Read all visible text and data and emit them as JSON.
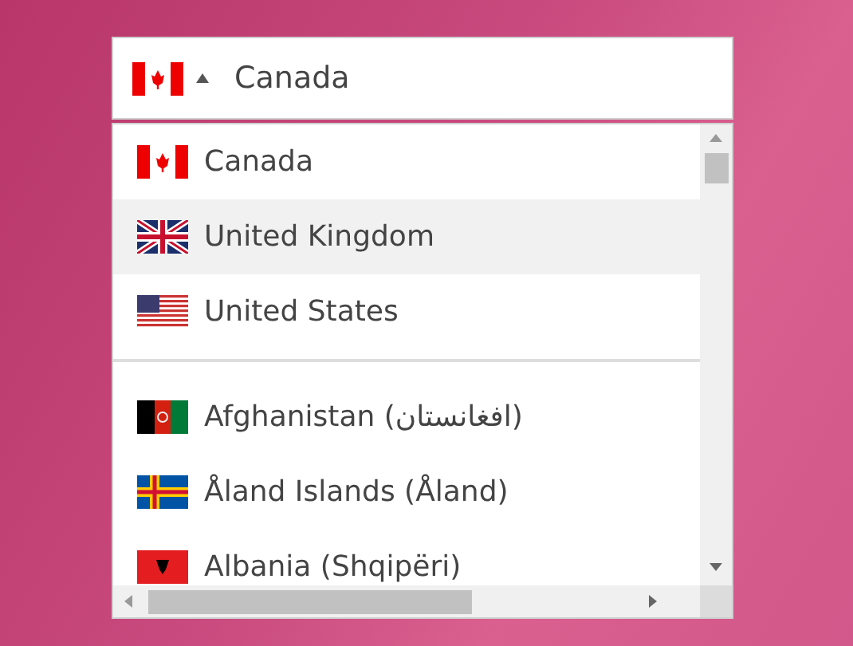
{
  "selected_country": {
    "kind": "ca",
    "value": "Canada",
    "expanded": true
  },
  "preferred": [
    {
      "kind": "ca",
      "name": "Canada",
      "highlighted": false
    },
    {
      "kind": "gb",
      "name": "United Kingdom",
      "highlighted": true
    },
    {
      "kind": "us",
      "name": "United States",
      "highlighted": false
    }
  ],
  "countries": [
    {
      "kind": "af",
      "name": "Afghanistan (افغانستان)",
      "highlighted": false
    },
    {
      "kind": "ax",
      "name": "Åland Islands (Åland)",
      "highlighted": false
    },
    {
      "kind": "al",
      "name": "Albania (Shqipëri)",
      "highlighted": false
    }
  ]
}
